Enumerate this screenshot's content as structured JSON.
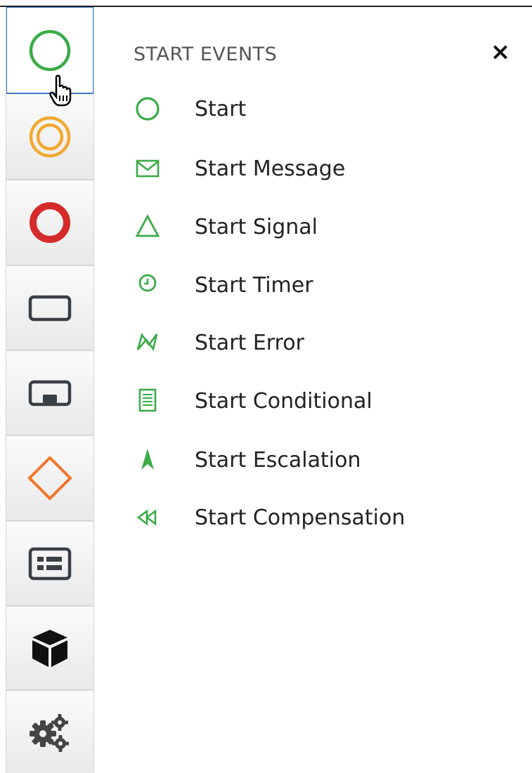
{
  "colors": {
    "start_green": "#3bab48",
    "intermediate_orange": "#f0a92f",
    "end_red": "#d52b2b",
    "task_gray": "#3a3f45",
    "gateway_orange": "#f2742a",
    "active_border": "#3c78c8"
  },
  "toolbar": {
    "tools": [
      {
        "name": "start-events-tool",
        "icon": "circle-outline-icon"
      },
      {
        "name": "intermediate-events-tool",
        "icon": "double-circle-icon"
      },
      {
        "name": "end-events-tool",
        "icon": "thick-circle-icon"
      },
      {
        "name": "tasks-tool",
        "icon": "rectangle-icon"
      },
      {
        "name": "subprocess-tool",
        "icon": "subprocess-icon"
      },
      {
        "name": "gateways-tool",
        "icon": "diamond-icon"
      },
      {
        "name": "containers-tool",
        "icon": "form-icon"
      },
      {
        "name": "artifacts-tool",
        "icon": "cube-icon"
      },
      {
        "name": "custom-tasks-tool",
        "icon": "gears-icon"
      }
    ]
  },
  "panel": {
    "title": "START EVENTS",
    "close_label": "×",
    "items": [
      {
        "label": "Start",
        "icon": "start-icon"
      },
      {
        "label": "Start Message",
        "icon": "message-icon"
      },
      {
        "label": "Start Signal",
        "icon": "signal-icon"
      },
      {
        "label": "Start Timer",
        "icon": "timer-icon"
      },
      {
        "label": "Start Error",
        "icon": "error-icon"
      },
      {
        "label": "Start Conditional",
        "icon": "conditional-icon"
      },
      {
        "label": "Start Escalation",
        "icon": "escalation-icon"
      },
      {
        "label": "Start Compensation",
        "icon": "compensation-icon"
      }
    ]
  }
}
